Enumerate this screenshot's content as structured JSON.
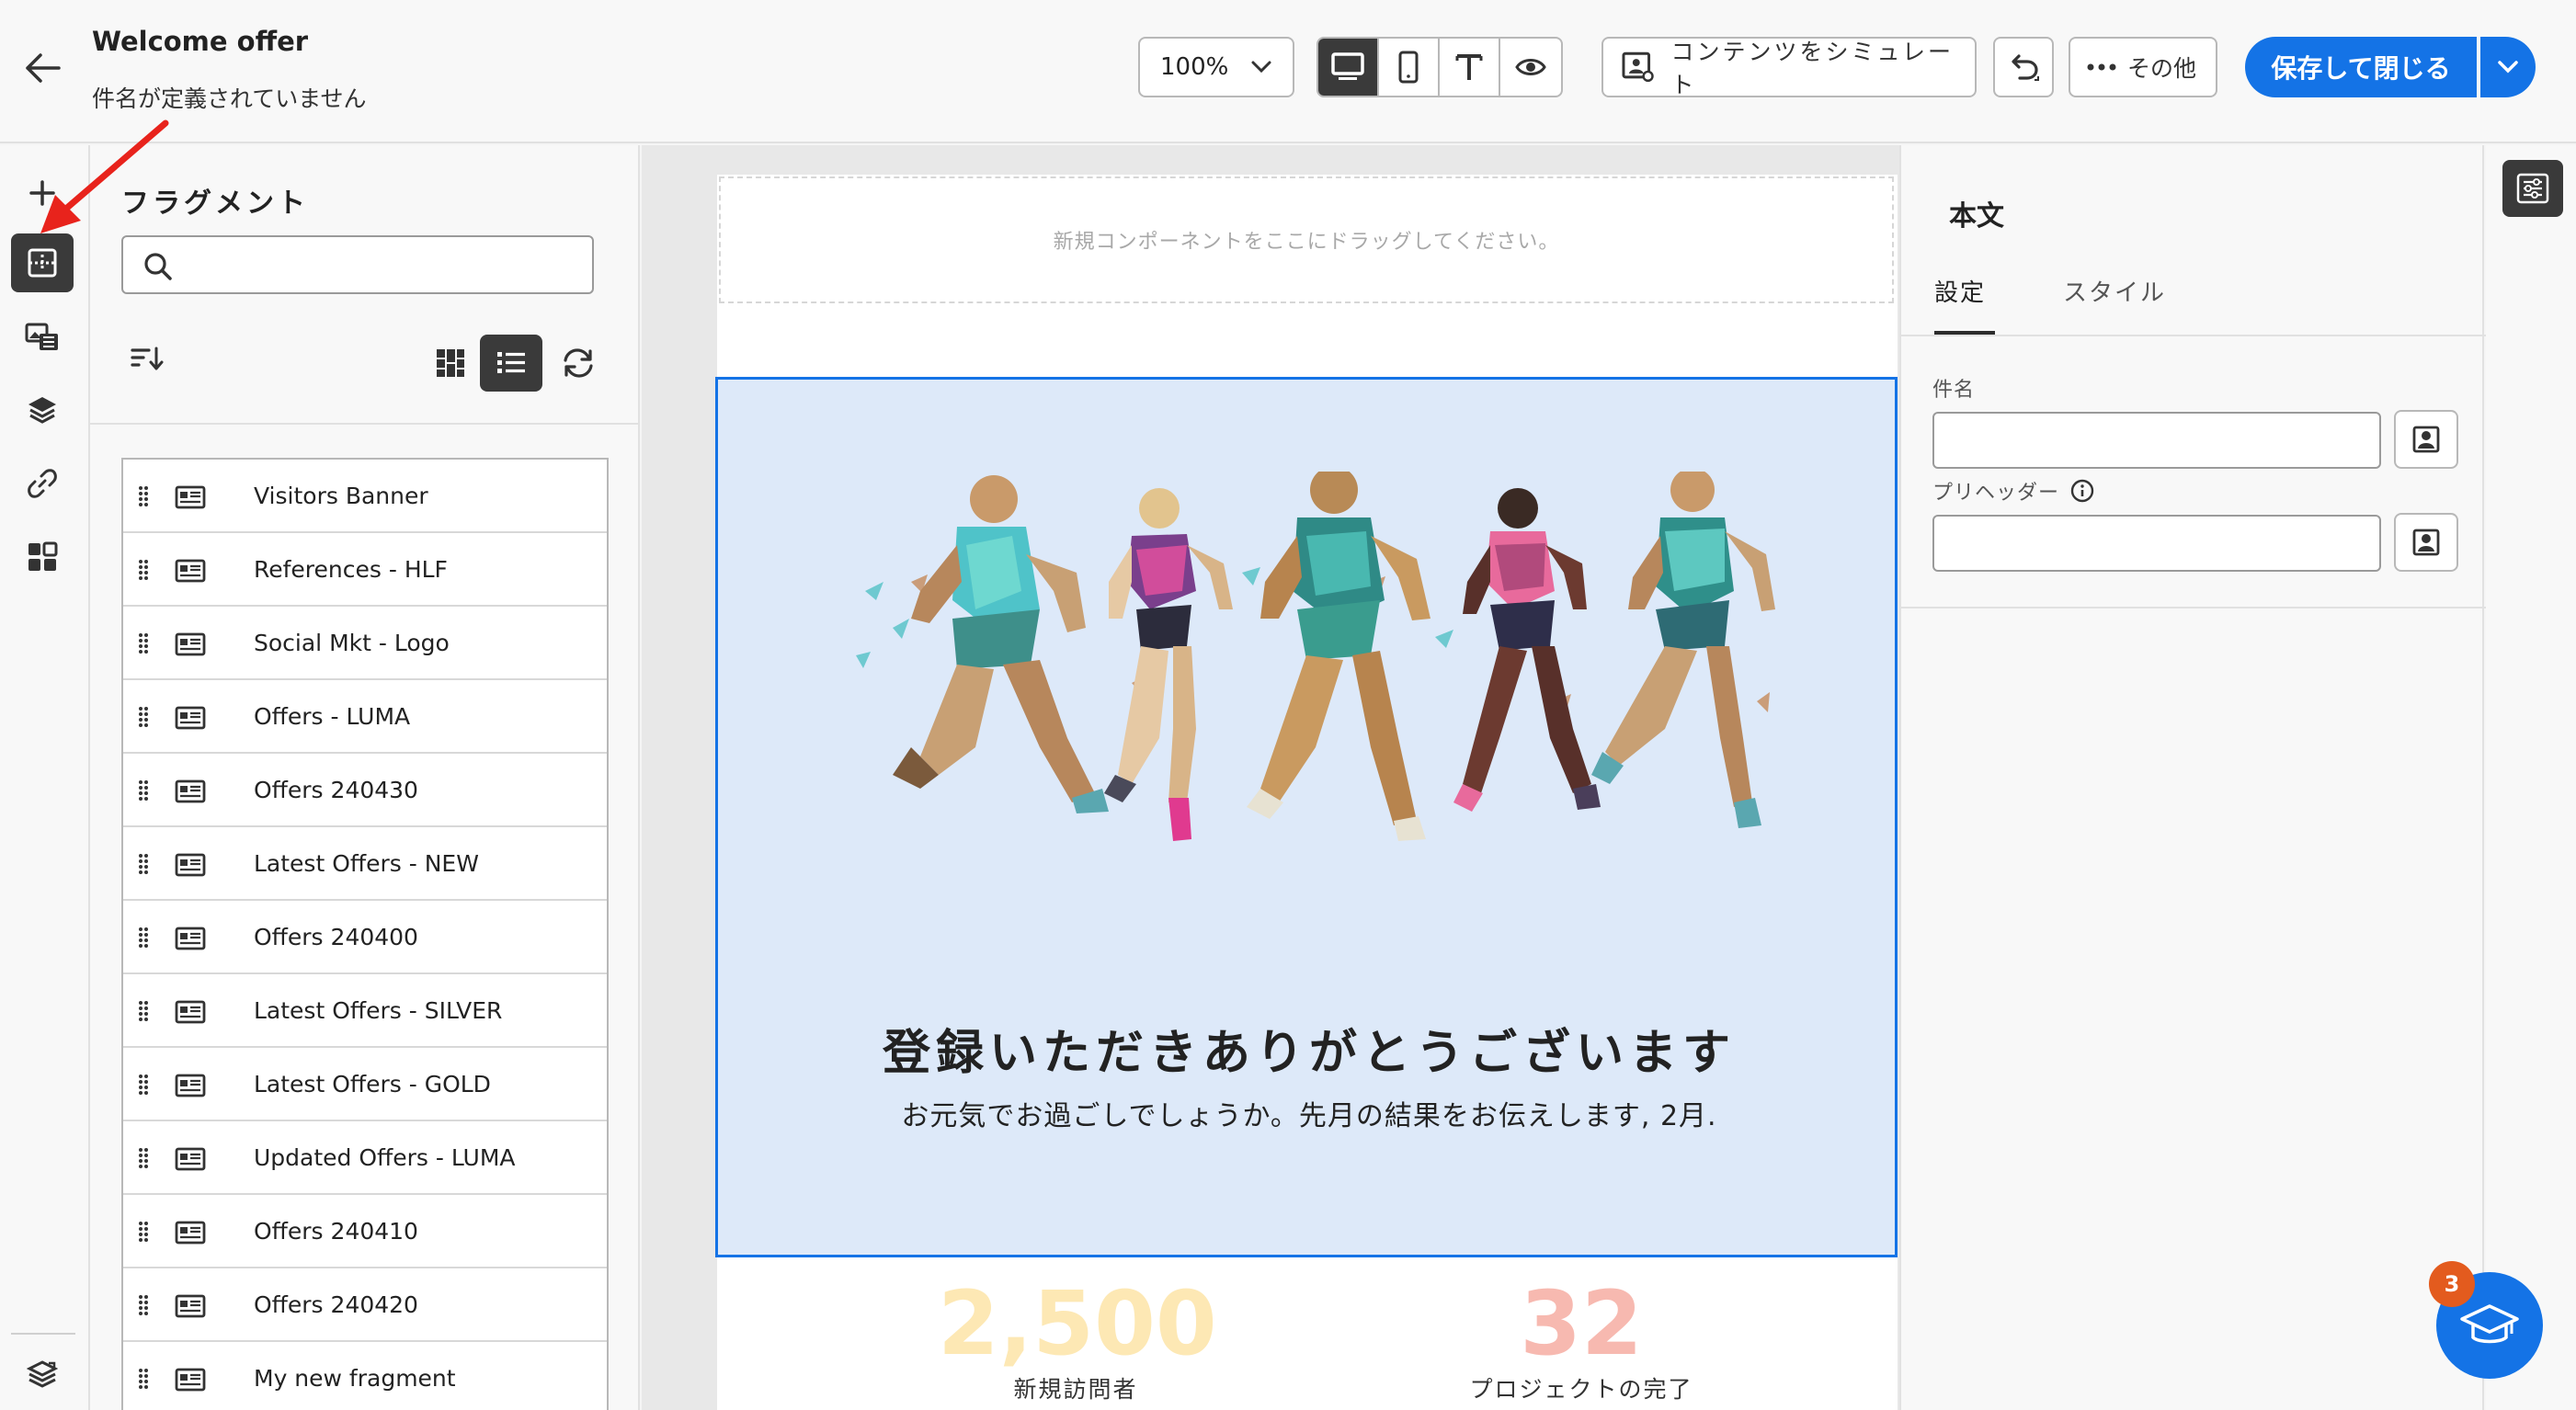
{
  "header": {
    "title": "Welcome offer",
    "subtitle": "件名が定義されていません",
    "zoom": "100%",
    "simulate_label": "コンテンツをシミュレート",
    "more_label": "その他",
    "save_label": "保存して閉じる"
  },
  "fragments": {
    "title": "フラグメント",
    "search_value": "",
    "items": [
      {
        "label": "Visitors Banner"
      },
      {
        "label": "References - HLF"
      },
      {
        "label": "Social Mkt - Logo"
      },
      {
        "label": "Offers - LUMA"
      },
      {
        "label": "Offers 240430"
      },
      {
        "label": "Latest Offers - NEW"
      },
      {
        "label": "Offers 240400"
      },
      {
        "label": "Latest Offers - SILVER"
      },
      {
        "label": "Latest Offers - GOLD"
      },
      {
        "label": "Updated Offers - LUMA"
      },
      {
        "label": "Offers 240410"
      },
      {
        "label": "Offers 240420"
      },
      {
        "label": "My new fragment"
      }
    ]
  },
  "canvas": {
    "drop_zone_text": "新規コンポーネントをここにドラッグしてください。",
    "hero_title": "登録いただきありがとうございます",
    "hero_subtitle": "お元気でお過ごしでしょうか。先月の結果をお伝えします, 2月.",
    "stats": [
      {
        "value": "2,500",
        "label": "新規訪問者",
        "color": "#fde8b4"
      },
      {
        "value": "32",
        "label": "プロジェクトの完了",
        "color": "#f7b9b0"
      }
    ],
    "hero_bg": "#dde9f9",
    "selection_color": "#1473e6"
  },
  "properties": {
    "title": "本文",
    "tabs": [
      {
        "label": "設定",
        "active": true
      },
      {
        "label": "スタイル",
        "active": false
      }
    ],
    "subject_label": "件名",
    "subject_value": "",
    "preheader_label": "プリヘッダー",
    "preheader_value": ""
  },
  "help": {
    "badge_count": "3"
  },
  "colors": {
    "accent": "#1473e6",
    "annotation_arrow": "#e8231c",
    "active_tool": "#3a3a3a"
  }
}
